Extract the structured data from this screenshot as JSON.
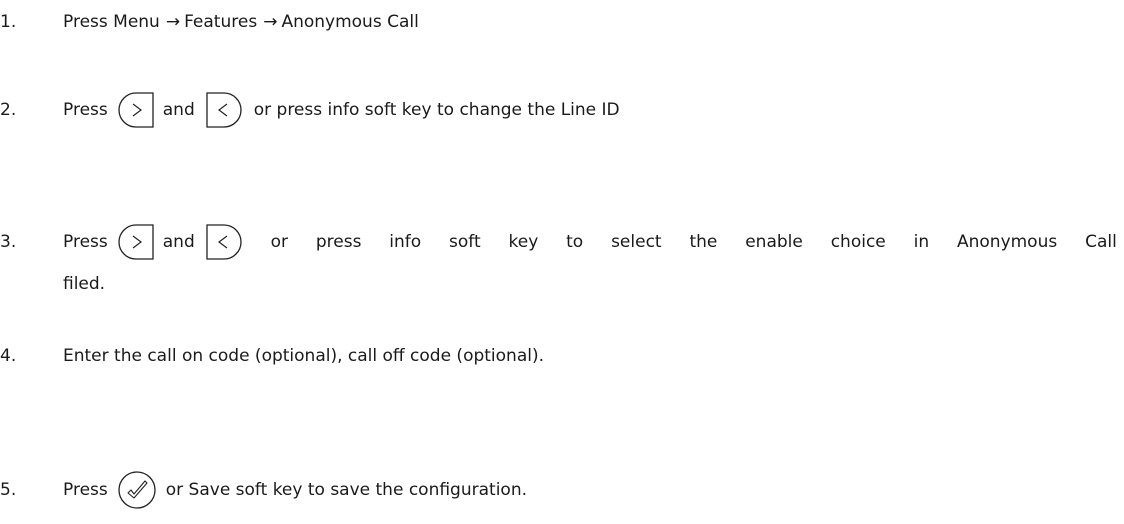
{
  "steps": [
    {
      "number": "1.",
      "text_press": "Press Menu",
      "features": "Features",
      "anonymous_call": "Anonymous Call"
    },
    {
      "number": "2.",
      "press": "Press",
      "and": "and",
      "rest": "or press info soft key to change the Line ID"
    },
    {
      "number": "3.",
      "press": "Press",
      "and": "and",
      "rest_words": [
        "or",
        "press",
        "info",
        "soft",
        "key",
        "to",
        "select",
        "the",
        "enable",
        "choice",
        "in",
        "Anonymous",
        "Call"
      ],
      "continuation": "filed."
    },
    {
      "number": "4.",
      "text": "Enter the call on code (optional), call off code (optional)."
    },
    {
      "number": "5.",
      "press": "Press",
      "rest": "or Save soft key to save the configuration."
    }
  ],
  "icons": {
    "arrow": "→",
    "right_key": "right-navigation-key-icon",
    "left_key": "left-navigation-key-icon",
    "ok_key": "ok-confirm-key-icon"
  }
}
